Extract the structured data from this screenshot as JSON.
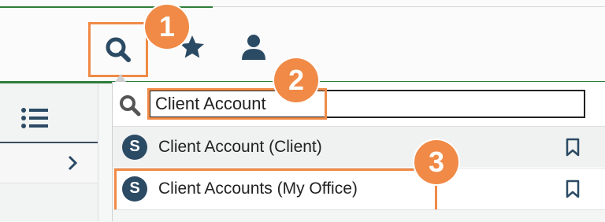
{
  "toolbar": {
    "search_icon": "search-icon",
    "favorites_icon": "star-icon",
    "user_icon": "user-icon"
  },
  "callouts": [
    "1",
    "2",
    "3"
  ],
  "left_panel": {
    "list_icon": "list-icon",
    "chevron_icon": "chevron-right-icon"
  },
  "search": {
    "value": "Client Account",
    "placeholder": ""
  },
  "results": [
    {
      "badge": "S",
      "label": "Client Account (Client)",
      "icon": "bookmark-icon"
    },
    {
      "badge": "S",
      "label": "Client Accounts (My Office)",
      "icon": "bookmark-icon"
    }
  ],
  "colors": {
    "accent_orange": "#f08a46",
    "navy": "#2b4a64",
    "green": "#2e7d3a"
  }
}
